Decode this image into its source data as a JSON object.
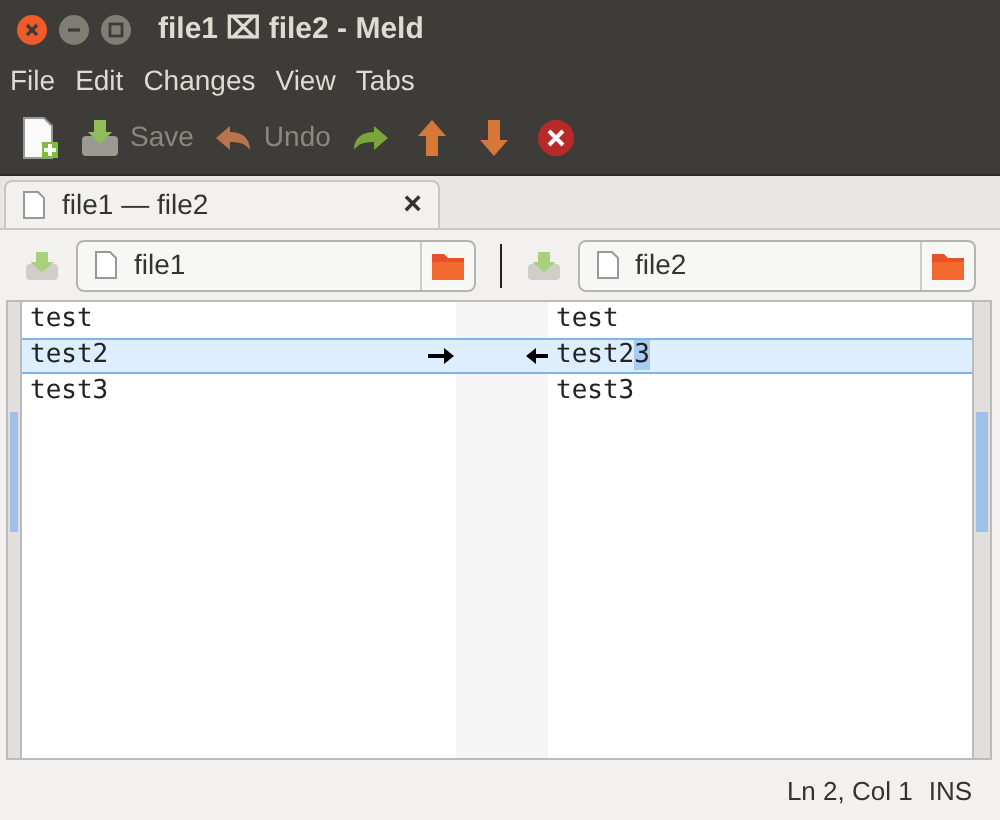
{
  "window": {
    "title": "file1 ⌧ file2 - Meld"
  },
  "menu": [
    "File",
    "Edit",
    "Changes",
    "View",
    "Tabs"
  ],
  "toolbar": [
    {
      "kind": "new"
    },
    {
      "kind": "save",
      "label": "Save",
      "disabled": true
    },
    {
      "kind": "undo",
      "label": "Undo",
      "disabled": true
    },
    {
      "kind": "redo"
    },
    {
      "kind": "up"
    },
    {
      "kind": "down"
    },
    {
      "kind": "stop"
    }
  ],
  "tabs": [
    {
      "label": "file1 — file2",
      "selected": true,
      "close": "×"
    }
  ],
  "panes": [
    {
      "file": "file1",
      "lines": [
        {
          "text": "test",
          "highlighted": false
        },
        {
          "text": "test2",
          "highlighted": true
        },
        {
          "text": "test3",
          "highlighted": false
        }
      ]
    },
    {
      "file": "file2",
      "lines": [
        {
          "text": "test",
          "highlighted": false
        },
        {
          "text": "test2",
          "highlighted": true,
          "selection": "3"
        },
        {
          "text": "test3",
          "highlighted": false
        }
      ]
    }
  ],
  "status_bar": {
    "position": "Ln 2, Col 1",
    "mode": "INS"
  }
}
